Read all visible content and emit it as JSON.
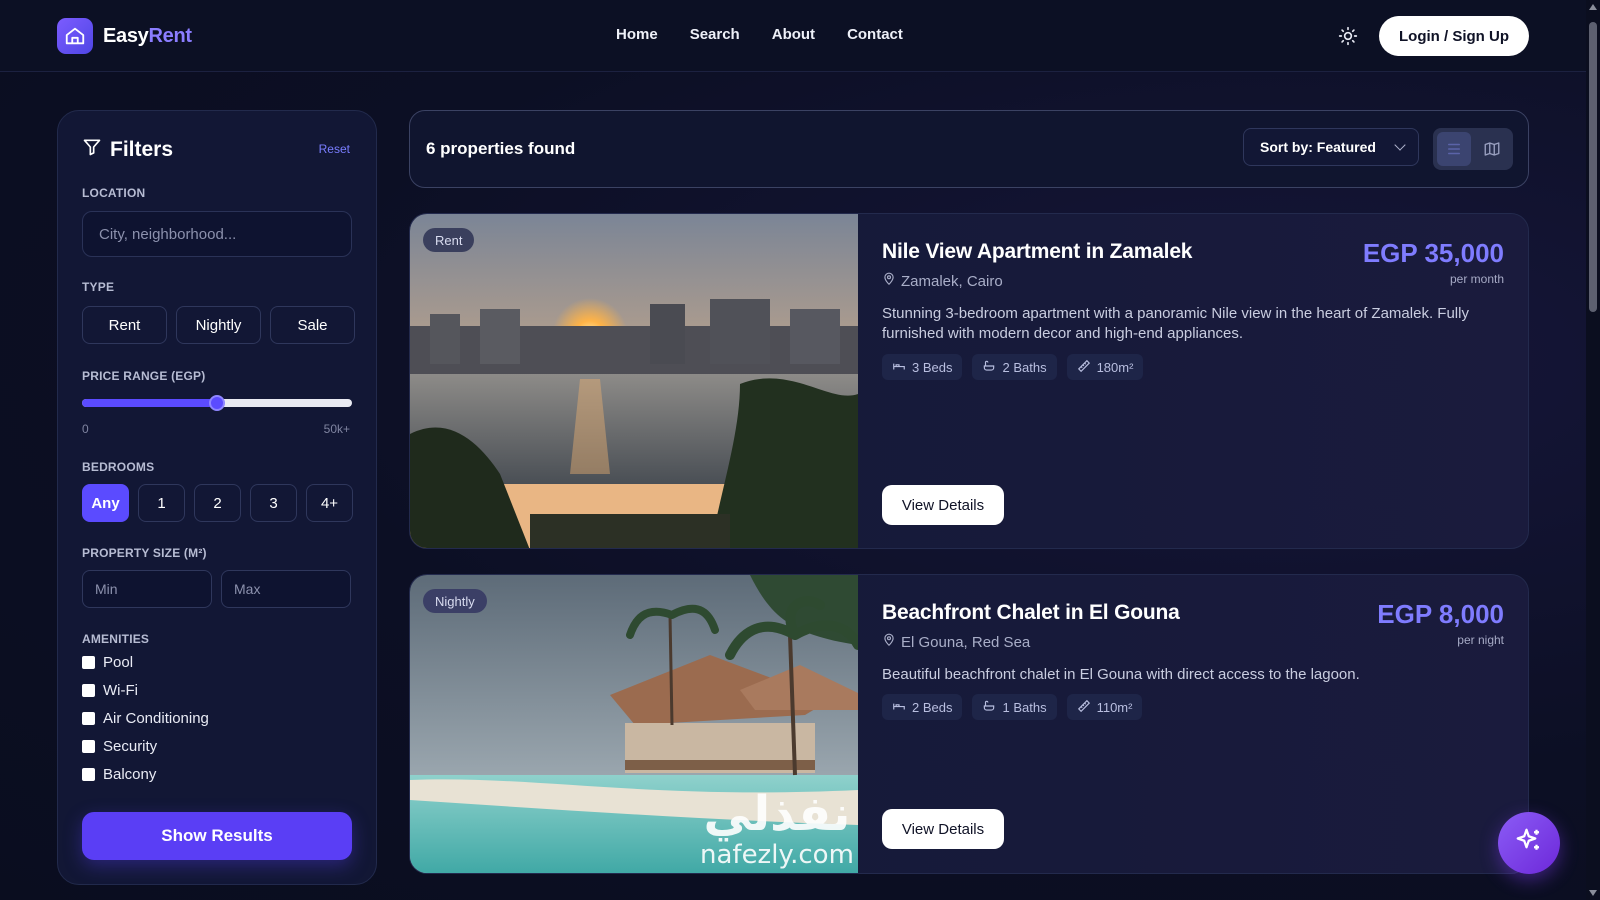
{
  "brand": {
    "name_part1": "Easy",
    "name_part2": "Rent",
    "accent": "#8b7dff"
  },
  "nav": {
    "home": "Home",
    "search": "Search",
    "about": "About",
    "contact": "Contact"
  },
  "header": {
    "login_label": "Login / Sign Up",
    "theme_icon": "sun-icon"
  },
  "filters": {
    "title": "Filters",
    "reset": "Reset",
    "location_label": "LOCATION",
    "location_placeholder": "City, neighborhood...",
    "type_label": "TYPE",
    "types": [
      "Rent",
      "Nightly",
      "Sale"
    ],
    "price_label": "PRICE RANGE (EGP)",
    "price_min_label": "0",
    "price_max_label": "50k+",
    "price_slider_fraction": 0.5,
    "bedrooms_label": "BEDROOMS",
    "bedrooms": [
      "Any",
      "1",
      "2",
      "3",
      "4+"
    ],
    "bedrooms_selected": "Any",
    "size_label": "PROPERTY SIZE (M²)",
    "size_min_placeholder": "Min",
    "size_max_placeholder": "Max",
    "amenities_label": "AMENITIES",
    "amenities": [
      "Pool",
      "Wi-Fi",
      "Air Conditioning",
      "Security",
      "Balcony"
    ],
    "show_results": "Show Results"
  },
  "results": {
    "count_text": "6 properties found",
    "sort_label": "Sort by: Featured",
    "view_list_icon": "list-view-icon",
    "view_map_icon": "map-view-icon"
  },
  "properties": [
    {
      "badge": "Rent",
      "title": "Nile View Apartment in Zamalek",
      "location": "Zamalek, Cairo",
      "price": "EGP 35,000",
      "price_unit": "per month",
      "description": "Stunning 3-bedroom apartment with a panoramic Nile view in the heart of Zamalek. Fully furnished with modern decor and high-end appliances.",
      "beds": "3 Beds",
      "baths": "2 Baths",
      "area": "180m²",
      "cta": "View Details"
    },
    {
      "badge": "Nightly",
      "title": "Beachfront Chalet in El Gouna",
      "location": "El Gouna, Red Sea",
      "price": "EGP 8,000",
      "price_unit": "per night",
      "description": "Beautiful beachfront chalet in El Gouna with direct access to the lagoon.",
      "beds": "2 Beds",
      "baths": "1 Baths",
      "area": "110m²",
      "cta": "View Details"
    }
  ],
  "watermark": {
    "arabic": "نفذلي",
    "latin": "nafezly.com"
  },
  "fab_icon": "sparkles-icon"
}
